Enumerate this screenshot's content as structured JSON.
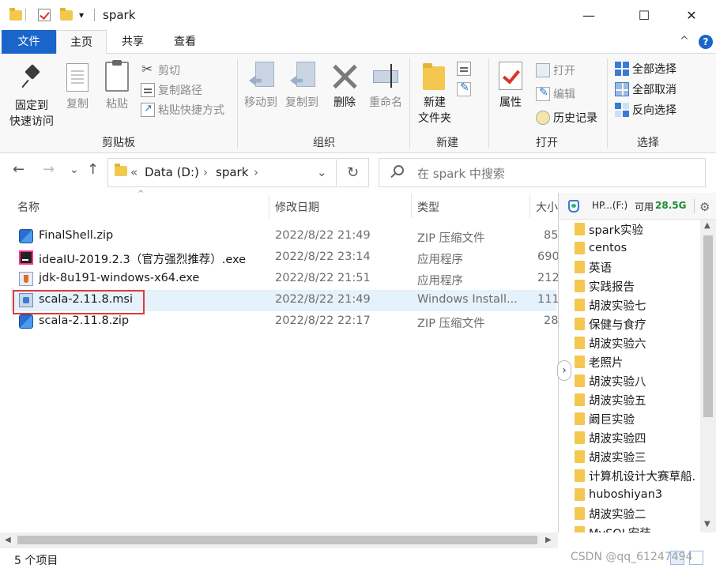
{
  "window": {
    "title": "spark",
    "minimize_glyph": "—",
    "maximize_glyph": "☐",
    "close_glyph": "✕",
    "qa_dropdown_glyph": "▾"
  },
  "ribbon_tabs": {
    "file": "文件",
    "home": "主页",
    "share": "共享",
    "view": "查看",
    "collapse_glyph": "^",
    "help_glyph": "?"
  },
  "ribbon": {
    "clipboard": {
      "label": "剪贴板",
      "pin_line1": "固定到",
      "pin_line2": "快速访问",
      "copy": "复制",
      "paste": "粘贴",
      "cut": "剪切",
      "copy_path": "复制路径",
      "paste_shortcut": "粘贴快捷方式"
    },
    "organize": {
      "label": "组织",
      "move_to": "移动到",
      "copy_to": "复制到",
      "delete": "删除",
      "rename": "重命名"
    },
    "new": {
      "label": "新建",
      "new_folder_line1": "新建",
      "new_folder_line2": "文件夹"
    },
    "open": {
      "label": "打开",
      "properties": "属性",
      "open": "打开",
      "edit": "编辑",
      "history": "历史记录"
    },
    "select": {
      "label": "选择",
      "select_all": "全部选择",
      "select_none": "全部取消",
      "invert": "反向选择"
    }
  },
  "nav": {
    "back_glyph": "←",
    "forward_glyph": "→",
    "recent_glyph": "⌄",
    "up_glyph": "↑",
    "crumb_prefix": "«",
    "crumb_drive": "Data (D:)",
    "crumb_sep": "›",
    "crumb_folder": "spark",
    "dropdown_glyph": "⌄",
    "refresh_glyph": "↻",
    "search_placeholder": "在 spark 中搜索"
  },
  "columns": {
    "name": "名称",
    "modified": "修改日期",
    "type": "类型",
    "size": "大小"
  },
  "files": [
    {
      "name": "FinalShell.zip",
      "modified": "2022/8/22 21:49",
      "type": "ZIP 压缩文件",
      "size": "85",
      "icon": "zip-icon"
    },
    {
      "name": "ideaIU-2019.2.3（官方强烈推荐）.exe",
      "modified": "2022/8/22 23:14",
      "type": "应用程序",
      "size": "690",
      "icon": "intellij-icon"
    },
    {
      "name": "jdk-8u191-windows-x64.exe",
      "modified": "2022/8/22 21:51",
      "type": "应用程序",
      "size": "212",
      "icon": "java-icon"
    },
    {
      "name": "scala-2.11.8.msi",
      "modified": "2022/8/22 21:49",
      "type": "Windows Install...",
      "size": "111",
      "icon": "installer-icon",
      "selected": true
    },
    {
      "name": "scala-2.11.8.zip",
      "modified": "2022/8/22 22:17",
      "type": "ZIP 压缩文件",
      "size": "28",
      "icon": "zip-icon"
    }
  ],
  "status": {
    "item_count": "5 个项目",
    "watermark": "CSDN @qq_61247494"
  },
  "drive_panel": {
    "drive_label": "HP...(F:)",
    "free_label": "可用",
    "free_value": "28.5G",
    "expand_glyph": "›",
    "folders": [
      "spark实验",
      "centos",
      "英语",
      "实践报告",
      "胡波实验七",
      "保健与食疗",
      "胡波实验六",
      "老照片",
      "胡波实验八",
      "胡波实验五",
      "阚巨实验",
      "胡波实验四",
      "胡波实验三",
      "计算机设计大赛草船.",
      "huboshiyan3",
      "胡波实验二",
      "MySQL安装"
    ]
  },
  "colors": {
    "accent": "#1a65c9",
    "selection": "#e5f1fb",
    "highlight_box": "#e03a3a",
    "free_space": "#1a8a35"
  }
}
